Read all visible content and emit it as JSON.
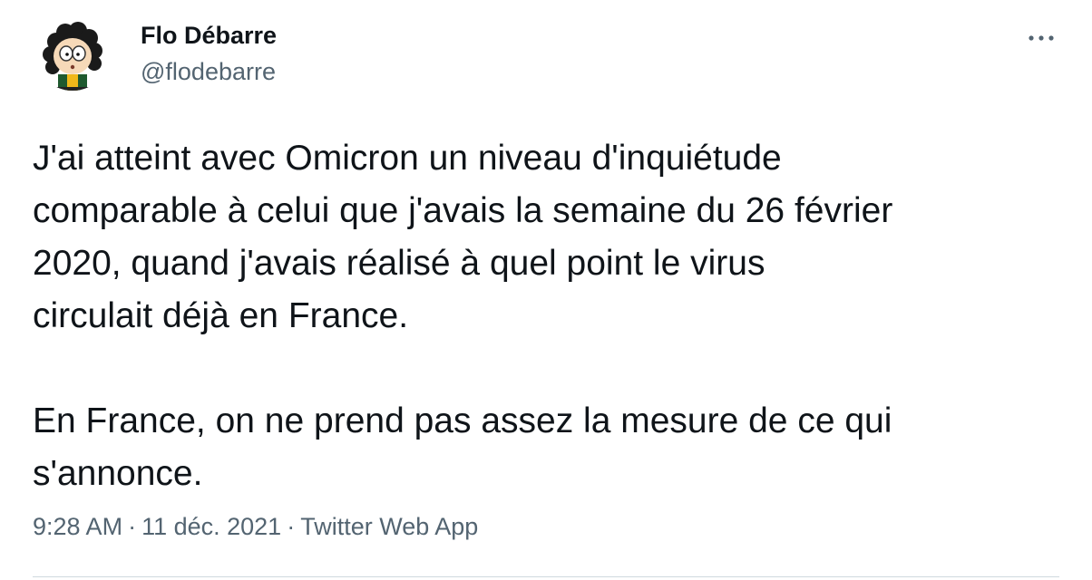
{
  "author": {
    "name": "Flo Débarre",
    "handle": "@flodebarre",
    "avatar_icon": "cartoon-avatar-icon"
  },
  "more_icon": "more-dots-icon",
  "tweet": {
    "text": "J'ai atteint avec Omicron un niveau d'inquiétude\ncomparable à celui que j'avais la semaine du 26 février\n2020, quand j'avais réalisé à quel point le virus\ncirculait déjà en France.\n\nEn France, on ne prend pas assez la mesure de ce qui\ns'annonce."
  },
  "meta": {
    "time": "9:28 AM",
    "separator": "·",
    "date": "11 déc. 2021",
    "source": "Twitter Web App"
  },
  "colors": {
    "text_primary": "#0f1419",
    "text_secondary": "#536471",
    "divider": "#cfd9de"
  }
}
